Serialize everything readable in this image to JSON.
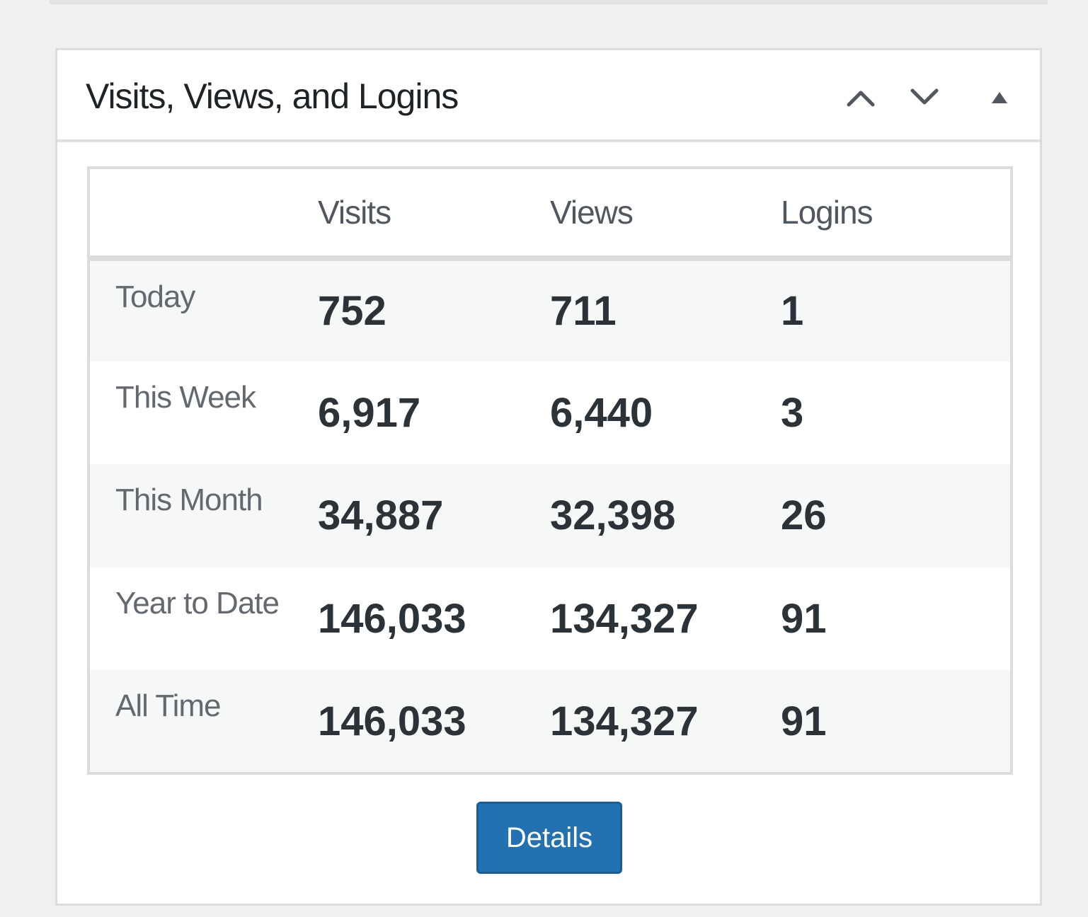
{
  "widget": {
    "title": "Visits, Views, and Logins",
    "controls": {
      "move_up_icon": "chevron-up-icon",
      "move_down_icon": "chevron-down-icon",
      "toggle_icon": "triangle-up-icon"
    }
  },
  "table": {
    "headers": [
      "",
      "Visits",
      "Views",
      "Logins"
    ],
    "rows": [
      {
        "label": "Today",
        "visits": "752",
        "views": "711",
        "logins": "1"
      },
      {
        "label": "This Week",
        "visits": "6,917",
        "views": "6,440",
        "logins": "3"
      },
      {
        "label": "This Month",
        "visits": "34,887",
        "views": "32,398",
        "logins": "26"
      },
      {
        "label": "Year to Date",
        "visits": "146,033",
        "views": "134,327",
        "logins": "91"
      },
      {
        "label": "All Time",
        "visits": "146,033",
        "views": "134,327",
        "logins": "91"
      }
    ]
  },
  "details_button": {
    "label": "Details"
  },
  "colors": {
    "page_background": "#f0f0f1",
    "panel_background": "#ffffff",
    "border": "#dcdcde",
    "button_primary": "#2271b1",
    "button_text": "#ffffff",
    "title_text": "#1d2327",
    "number_text": "#2c3338",
    "label_text": "#646970"
  }
}
